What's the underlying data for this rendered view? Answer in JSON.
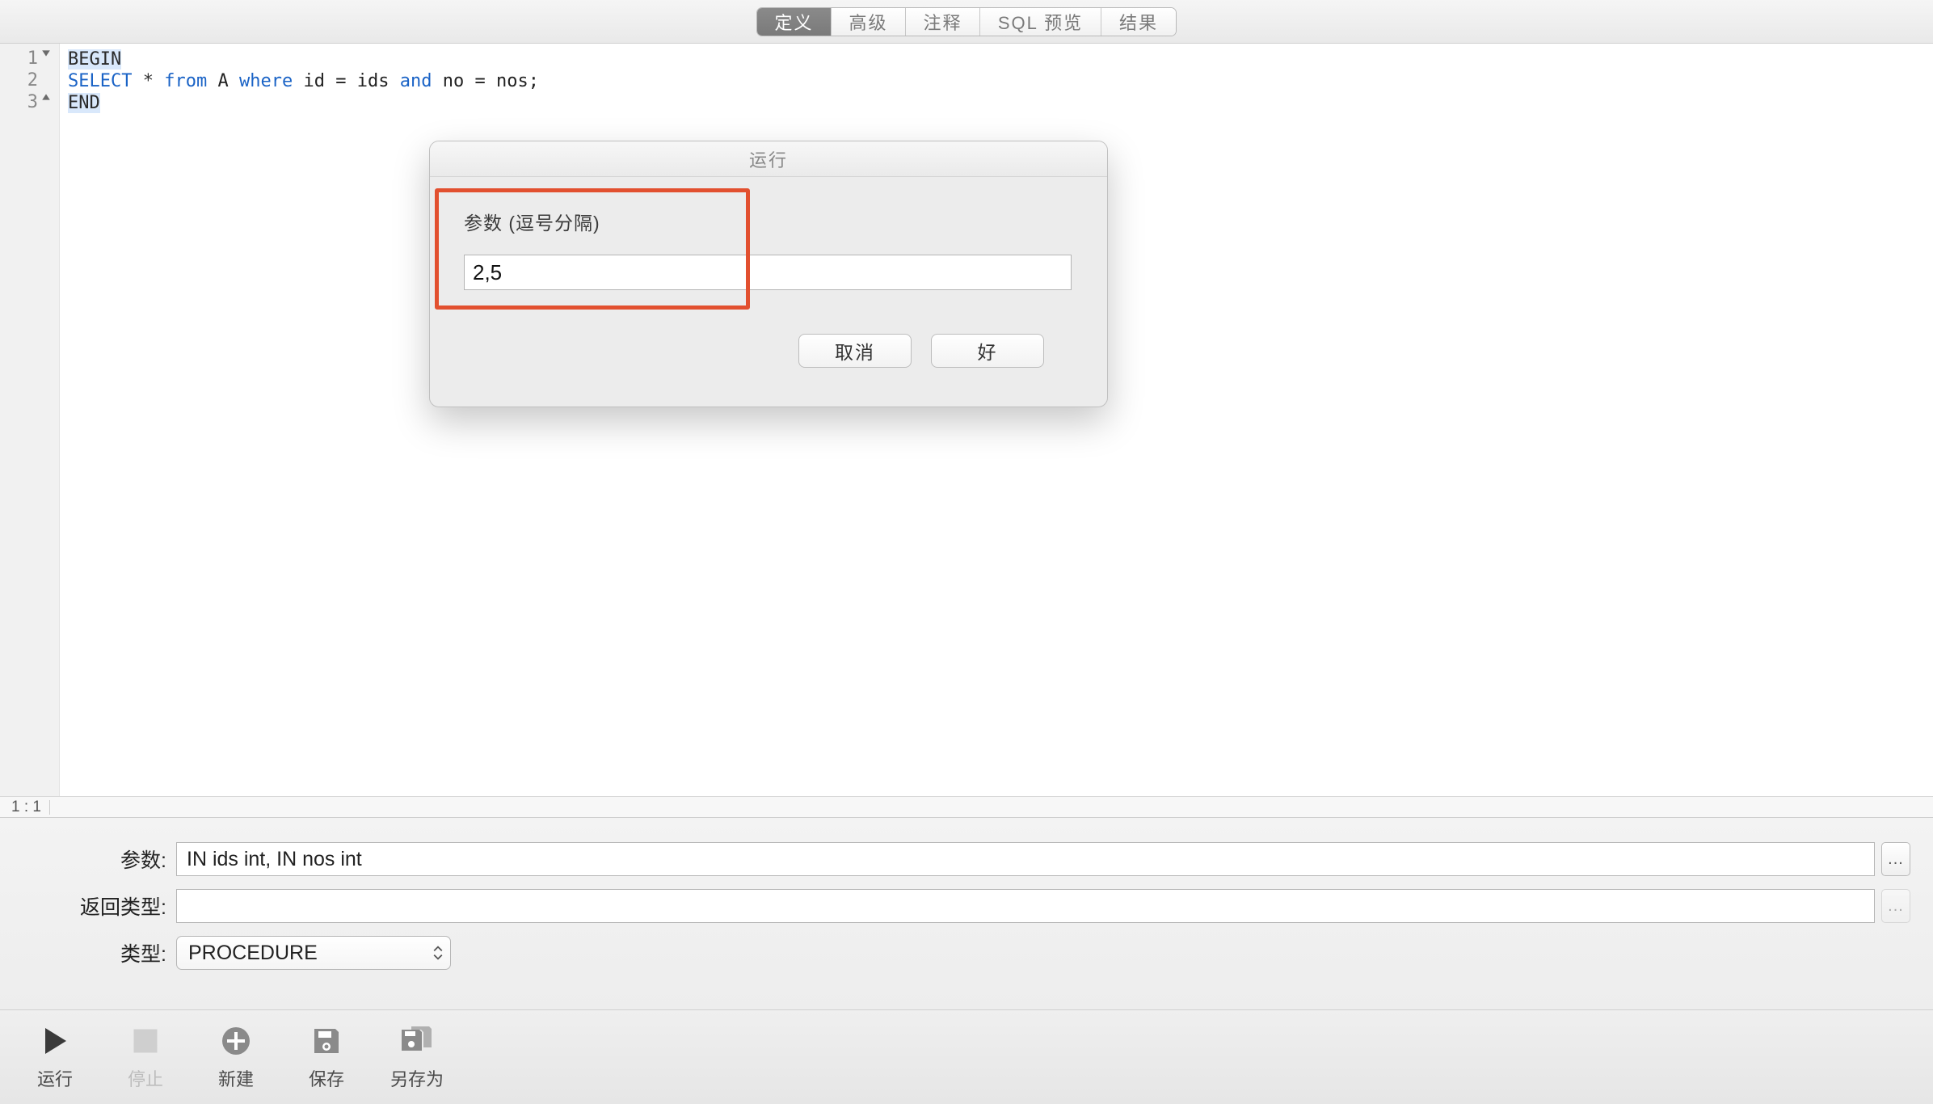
{
  "tabs": {
    "def": "定义",
    "adv": "高级",
    "cmt": "注释",
    "sql": "SQL 预览",
    "res": "结果"
  },
  "code": {
    "line1": "BEGIN",
    "line2_select": "SELECT",
    "line2_from": "from",
    "line2_tbl": "A",
    "line2_where": "where",
    "line2_id": "id",
    "line2_ids": "ids",
    "line2_and": "and",
    "line2_no": "no",
    "line2_nos": "nos;",
    "line2_star": "*",
    "line2_eq": "=",
    "line3": "END"
  },
  "status": {
    "pos": "1 : 1"
  },
  "form": {
    "params_label": "参数:",
    "params_value": "IN ids int, IN nos int",
    "return_label": "返回类型:",
    "return_value": "",
    "type_label": "类型:",
    "type_value": "PROCEDURE"
  },
  "actions": {
    "run": "运行",
    "stop": "停止",
    "new": "新建",
    "save": "保存",
    "saveas": "另存为"
  },
  "dialog": {
    "title": "运行",
    "param_label": "参数 (逗号分隔)",
    "param_value": "2,5",
    "cancel": "取消",
    "ok": "好"
  },
  "ellipsis": "..."
}
